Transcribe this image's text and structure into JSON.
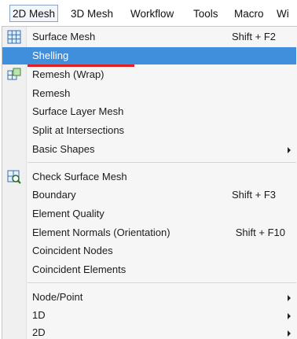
{
  "menubar": {
    "items": [
      "2D Mesh",
      "3D Mesh",
      "Workflow",
      "Tools",
      "Macro",
      "Wi"
    ]
  },
  "menu": {
    "items": [
      {
        "label": "Surface Mesh",
        "shortcut": "Shift + F2",
        "icon": "surface-mesh-icon"
      },
      {
        "label": "Shelling",
        "shortcut": "",
        "highlighted": true
      },
      {
        "label": "Remesh (Wrap)",
        "shortcut": "",
        "icon": "remesh-wrap-icon"
      },
      {
        "label": "Remesh",
        "shortcut": ""
      },
      {
        "label": "Surface Layer Mesh",
        "shortcut": ""
      },
      {
        "label": "Split at Intersections",
        "shortcut": ""
      },
      {
        "label": "Basic Shapes",
        "shortcut": "",
        "submenu": true
      },
      {
        "label": "Check Surface Mesh",
        "shortcut": "",
        "icon": "check-surface-mesh-icon"
      },
      {
        "label": "Boundary",
        "shortcut": "Shift + F3"
      },
      {
        "label": "Element Quality",
        "shortcut": ""
      },
      {
        "label": "Element Normals (Orientation)",
        "shortcut": "Shift + F10"
      },
      {
        "label": "Coincident Nodes",
        "shortcut": ""
      },
      {
        "label": "Coincident Elements",
        "shortcut": ""
      },
      {
        "label": "Node/Point",
        "shortcut": "",
        "submenu": true
      },
      {
        "label": "1D",
        "shortcut": "",
        "submenu": true
      },
      {
        "label": "2D",
        "shortcut": "",
        "submenu": true
      }
    ]
  },
  "colors": {
    "highlight": "#3f8fdd",
    "annotation": "#e02020"
  }
}
